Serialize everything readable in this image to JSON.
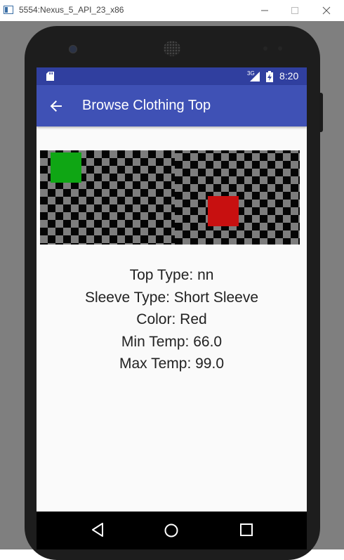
{
  "window": {
    "title": "5554:Nexus_5_API_23_x86",
    "icons": [
      "app-icon",
      "minimize-icon",
      "maximize-icon",
      "close-icon"
    ]
  },
  "status_bar": {
    "network": "3G",
    "time": "8:20",
    "icons": [
      "sd-card-icon",
      "signal-icon",
      "battery-charging-icon"
    ]
  },
  "app_bar": {
    "title": "Browse Clothing Top",
    "back_icon": "arrow-left-icon"
  },
  "image": {
    "description_icons": [
      "checkerboard-pattern",
      "green-square",
      "red-square"
    ],
    "colors": {
      "green": "#0fa614",
      "red": "#c81010",
      "checker_light": "#7d7d7d",
      "checker_dark": "#050505"
    }
  },
  "details": {
    "top_type": "Top Type: nn",
    "sleeve_type": "Sleeve Type: Short Sleeve",
    "color": "Color: Red",
    "min_temp": "Min Temp: 66.0",
    "max_temp": "Max Temp: 99.0"
  },
  "nav_bar": {
    "icons": [
      "nav-back-icon",
      "nav-home-icon",
      "nav-recents-icon"
    ]
  },
  "colors": {
    "primary": "#3f51b5",
    "primary_dark": "#303f9f",
    "screen_bg": "#fafafa"
  }
}
